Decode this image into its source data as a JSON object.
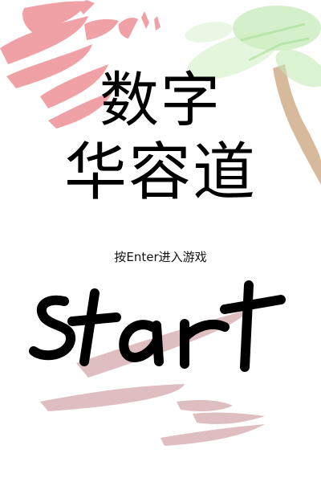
{
  "game": {
    "title_line_1": "数字",
    "title_line_2": "华容道",
    "hint": "按Enter进入游戏",
    "start_label": "start"
  },
  "colors": {
    "background": "#ffffff",
    "pink_brush": "#ee9a9f",
    "mauve_brush": "#d9b3b7",
    "palm_green": "#b8e6a8",
    "palm_trunk": "#c9a37a",
    "start_ink": "#000000"
  },
  "icons": {
    "start": "handwritten-start-word",
    "decoration_left": "pink-paint-strokes",
    "decoration_right": "palm-tree-sketch"
  }
}
